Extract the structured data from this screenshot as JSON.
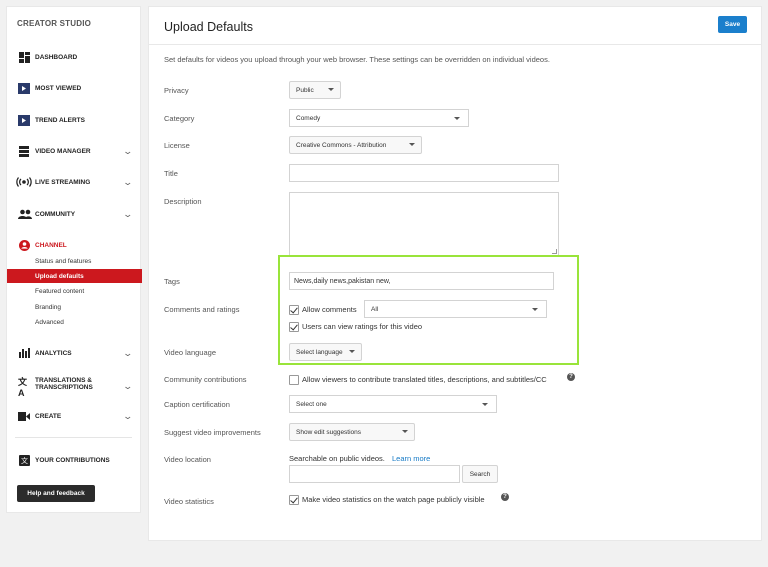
{
  "sidebar": {
    "title": "CREATOR STUDIO",
    "items": [
      {
        "label": "DASHBOARD"
      },
      {
        "label": "MOST VIEWED"
      },
      {
        "label": "TREND ALERTS"
      },
      {
        "label": "VIDEO MANAGER"
      },
      {
        "label": "LIVE STREAMING"
      },
      {
        "label": "COMMUNITY"
      },
      {
        "label": "CHANNEL"
      },
      {
        "label": "ANALYTICS"
      },
      {
        "label": "TRANSLATIONS &"
      },
      {
        "label": "TRANSCRIPTIONS"
      },
      {
        "label": "CREATE"
      },
      {
        "label": "YOUR CONTRIBUTIONS"
      }
    ],
    "channel_sub": [
      {
        "label": "Status and features"
      },
      {
        "label": "Upload defaults"
      },
      {
        "label": "Featured content"
      },
      {
        "label": "Branding"
      },
      {
        "label": "Advanced"
      }
    ],
    "help_button": "Help and feedback"
  },
  "main": {
    "title": "Upload Defaults",
    "save_label": "Save",
    "intro": "Set defaults for videos you upload through your web browser. These settings can be overridden on individual videos.",
    "privacy": {
      "label": "Privacy",
      "value": "Public"
    },
    "category": {
      "label": "Category",
      "value": "Comedy"
    },
    "license": {
      "label": "License",
      "value": "Creative Commons - Attribution"
    },
    "title_field": {
      "label": "Title",
      "value": ""
    },
    "description": {
      "label": "Description",
      "value": ""
    },
    "tags": {
      "label": "Tags",
      "value": "News,daily news,pakistan new,"
    },
    "comments": {
      "label": "Comments and ratings",
      "allow_label": "Allow comments",
      "allow_value": "All",
      "ratings_label": "Users can view ratings for this video"
    },
    "video_language": {
      "label": "Video language",
      "value": "Select language"
    },
    "community": {
      "label": "Community contributions",
      "checkbox_label": "Allow viewers to contribute translated titles, descriptions, and subtitles/CC"
    },
    "caption": {
      "label": "Caption certification",
      "value": "Select one"
    },
    "suggest": {
      "label": "Suggest video improvements",
      "value": "Show edit suggestions"
    },
    "location": {
      "label": "Video location",
      "text": "Searchable on public videos.",
      "link": "Learn more",
      "search_label": "Search",
      "input_value": ""
    },
    "statistics": {
      "label": "Video statistics",
      "checkbox_label": "Make video statistics on the watch page publicly visible"
    }
  },
  "colors": {
    "accent_red": "#cc181e",
    "save_blue": "#1b7fcc",
    "highlight_green": "#99e43a",
    "link_blue": "#167ac6"
  }
}
